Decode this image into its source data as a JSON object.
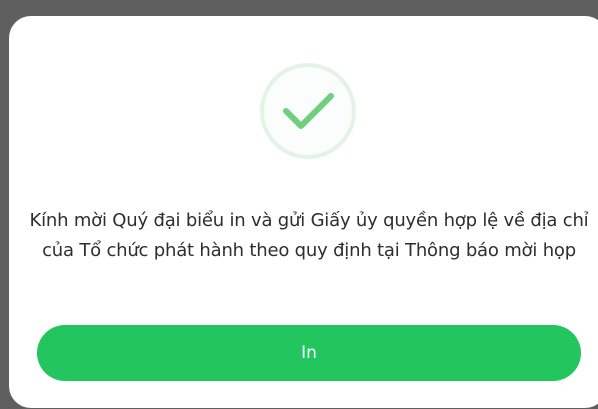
{
  "dialog": {
    "icon": "check-circle-icon",
    "message": "Kính mời Quý đại biểu in và gửi Giấy ủy quyền hợp lệ về địa chỉ của Tổ chức phát hành theo quy định tại Thông báo mời họp",
    "print_button_label": "In"
  },
  "colors": {
    "backdrop": "#5f5f5f",
    "surface": "#ffffff",
    "accent": "#22c55e",
    "check_ring": "#e3f4e7",
    "check_mark": "#6fcf7f",
    "text": "#2e2e2e"
  }
}
